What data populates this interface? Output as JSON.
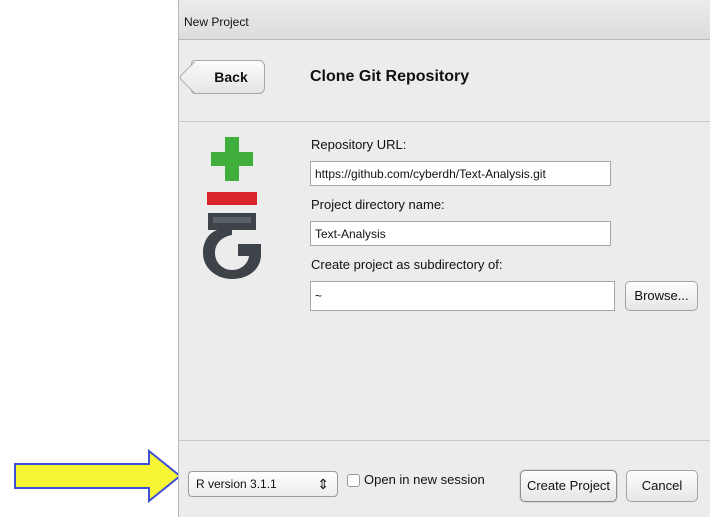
{
  "window": {
    "title": "New Project"
  },
  "header": {
    "back_label": "Back",
    "title": "Clone Git Repository"
  },
  "form": {
    "repo_url_label": "Repository URL:",
    "repo_url_value": "https://github.com/cyberdh/Text-Analysis.git",
    "dir_name_label": "Project directory name:",
    "dir_name_value": "Text-Analysis",
    "subdir_label": "Create project as subdirectory of:",
    "subdir_value": "~",
    "browse_label": "Browse..."
  },
  "footer": {
    "r_version": "R version 3.1.1",
    "open_new_session_label": "Open in new session",
    "open_new_session_checked": false,
    "create_label": "Create Project",
    "cancel_label": "Cancel"
  },
  "colors": {
    "annotation_arrow_fill": "#f5f534",
    "annotation_arrow_stroke": "#3f4fd6",
    "git_icon_plus": "#3fae3b",
    "git_icon_minus": "#d8252a",
    "git_icon_body": "#3e4349"
  },
  "icons": {
    "git_icon": "git-clone-icon",
    "annotation": "arrow-right-icon",
    "select_arrows": "updown-arrows-icon"
  }
}
